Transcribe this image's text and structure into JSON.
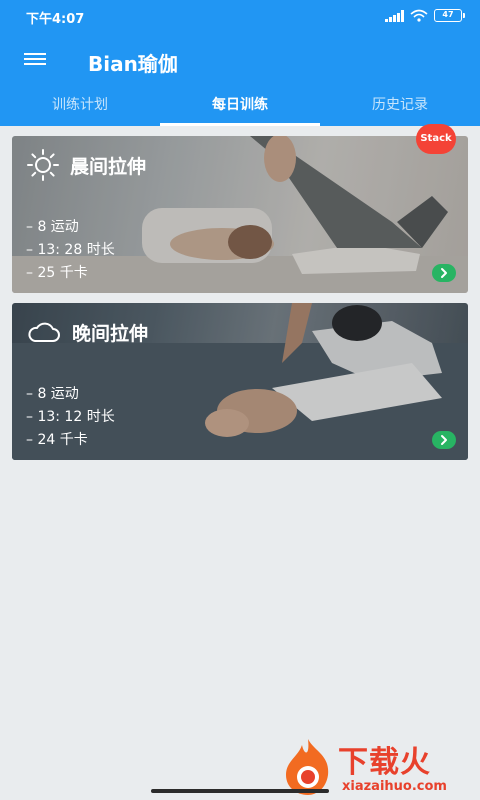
{
  "status_bar": {
    "time": "下午4:07",
    "battery": "47"
  },
  "app_bar": {
    "title": "Bian瑜伽"
  },
  "tabs": [
    {
      "label": "训练计划",
      "active": false
    },
    {
      "label": "每日训练",
      "active": true
    },
    {
      "label": "历史记录",
      "active": false
    }
  ],
  "cards": [
    {
      "icon": "sun-icon",
      "title": "晨间拉伸",
      "stats": [
        "– 8 运动",
        "– 13: 28 时长",
        "– 25 千卡"
      ],
      "badge": "Stack"
    },
    {
      "icon": "cloud-icon",
      "title": "晚间拉伸",
      "stats": [
        "– 8 运动",
        "– 13: 12 时长",
        "– 24 千卡"
      ]
    }
  ],
  "watermark": {
    "brand": "下载火",
    "domain": "xiazaihuo.com"
  },
  "colors": {
    "primary": "#2196f3",
    "go_button": "#28b463",
    "badge": "#f44336",
    "watermark": "#e8412c"
  }
}
